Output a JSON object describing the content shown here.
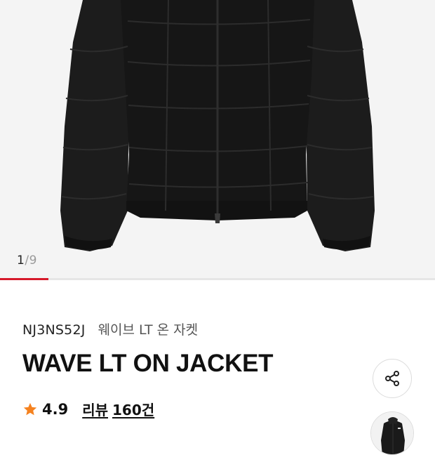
{
  "gallery": {
    "current": "1",
    "separator": "/",
    "total": "9",
    "progress_fraction": 0.111,
    "accent_color": "#d6192a",
    "background_color": "#f4f4f4"
  },
  "product": {
    "code": "NJ3NS52J",
    "korean_name": "웨이브 LT 온 자켓",
    "title": "WAVE LT ON JACKET"
  },
  "rating": {
    "star_icon": "star-icon",
    "star_color": "#f5821f",
    "score": "4.9",
    "review_label": "리뷰",
    "review_count": "160건"
  },
  "actions": {
    "share_icon": "share-icon"
  }
}
